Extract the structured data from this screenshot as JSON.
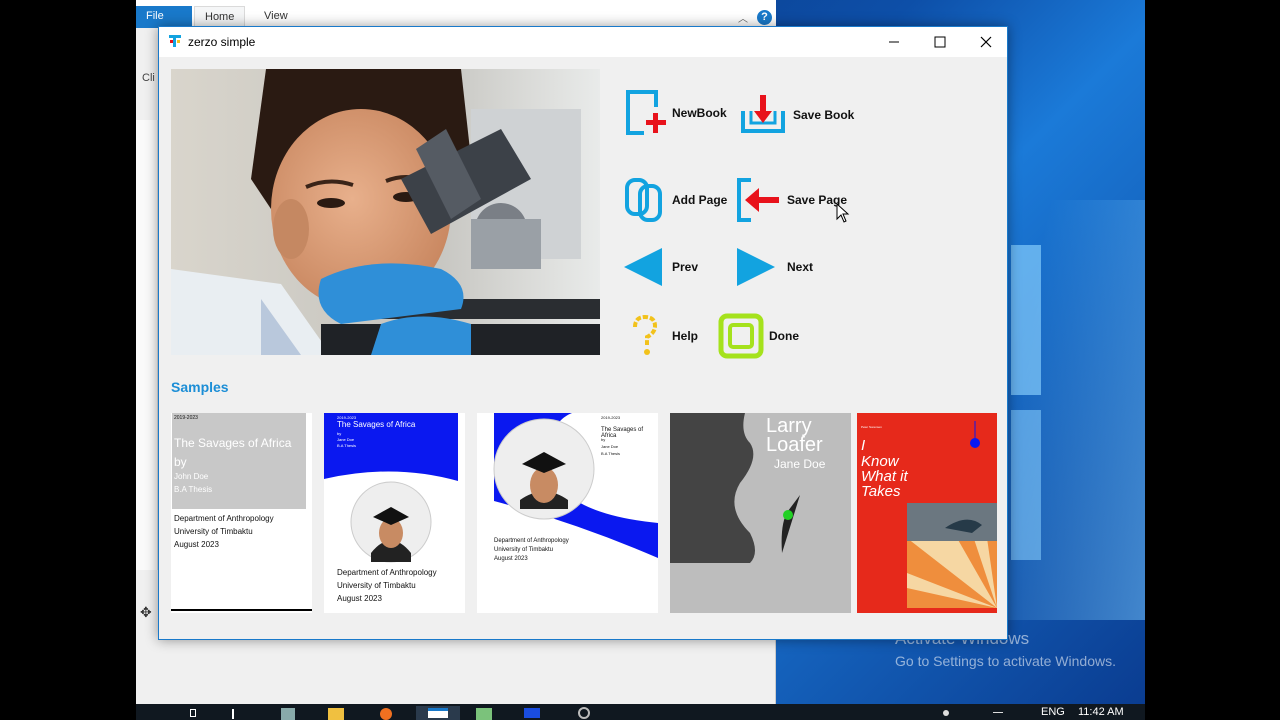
{
  "background_window": {
    "tabs": [
      "File",
      "Home",
      "View"
    ],
    "clip_label": "Cli",
    "help_label": "?"
  },
  "taskbar": {
    "language": "ENG",
    "time": "11:42 AM"
  },
  "watermark": {
    "line1": "Activate Windows",
    "line2": "Go to Settings to activate Windows."
  },
  "app": {
    "title": "zerzo simple",
    "controls": {
      "minimize": "—",
      "maximize": "☐",
      "close": "✕"
    },
    "icons": {
      "newbook": "new-book-icon",
      "savebook": "save-book-icon",
      "addpage": "add-page-icon",
      "savepage": "save-page-icon",
      "prev": "prev-arrow-icon",
      "next": "next-arrow-icon",
      "help": "question-mark-icon",
      "done": "done-square-icon"
    },
    "actions": {
      "newbook": "NewBook",
      "savebook": "Save Book",
      "addpage": "Add Page",
      "savepage": "Save Page",
      "prev": "Prev",
      "next": "Next",
      "help": "Help",
      "done": "Done"
    },
    "samples_title": "Samples",
    "samples": [
      {
        "year": "2019-2023",
        "title": "The Savages of Africa",
        "by": "by",
        "author": "John Doe",
        "degree": "B.A Thesis",
        "dept": "Department of Anthropology",
        "univ": "University of Timbaktu",
        "date": "August 2023"
      },
      {
        "year": "2019-2023",
        "title": "The Savages of Africa",
        "by": "by",
        "author": "Jane Doe",
        "degree": "B.A Thesis",
        "dept": "Department of Anthropology",
        "univ": "University of Timbaktu",
        "date": "August 2023"
      },
      {
        "year": "2019-2023",
        "title": "The Savages of Africa",
        "by": "by",
        "author": "Jane Doe",
        "degree": "B.A Thesis",
        "dept": "Department of Anthropology",
        "univ": "University of Timbaktu",
        "date": "August 2023"
      },
      {
        "title_line1": "Larry",
        "title_line2": "Loafer",
        "author": "Jane Doe"
      },
      {
        "author": "Peter Sorensen",
        "title_line1": "I",
        "title_line2": "Know",
        "title_line3": "What it",
        "title_line4": "Takes"
      }
    ],
    "colors": {
      "accent": "#1c8ed6",
      "icon_blue": "#12a3e0",
      "icon_red": "#e8121b",
      "help_yellow": "#f2c21b",
      "done_green": "#a5e21c",
      "sample_blue": "#0a18f0",
      "sample_red": "#e6291b"
    }
  }
}
